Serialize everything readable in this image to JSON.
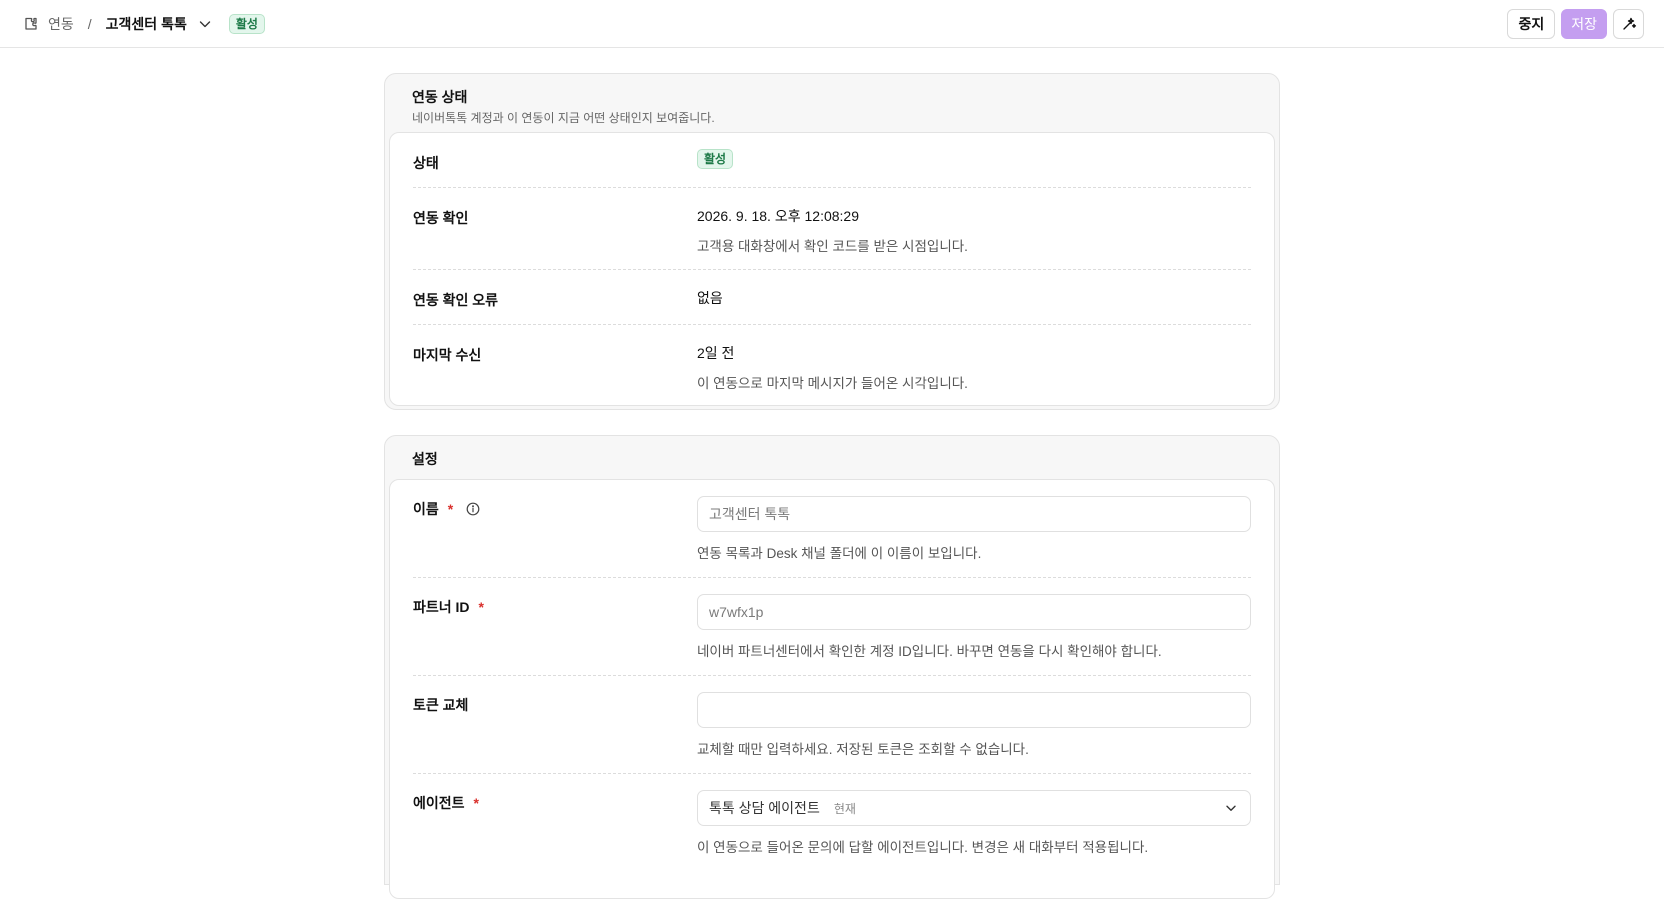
{
  "breadcrumb": {
    "root_icon": "plug-icon",
    "root_label": "연동",
    "separator": "/",
    "current_label": "고객센터 톡톡",
    "status_badge": "활성"
  },
  "toolbar": {
    "stop_label": "중지",
    "save_label": "저장",
    "ai_icon": "sparkle-icon"
  },
  "status_card": {
    "title": "연동 상태",
    "description": "네이버톡톡 계정과 이 연동이 지금 어떤 상태인지 보여줍니다.",
    "rows": [
      {
        "label": "상태",
        "badge": "활성"
      },
      {
        "label": "연동 확인",
        "value": "2026. 9. 18. 오후 12:08:29",
        "sub": "고객용 대화창에서 확인 코드를 받은 시점입니다."
      },
      {
        "label": "연동 확인 오류",
        "value": "없음"
      },
      {
        "label": "마지막 수신",
        "value": "2일 전",
        "sub": "이 연동으로 마지막 메시지가 들어온 시각입니다."
      }
    ]
  },
  "settings_card": {
    "title": "설정",
    "name_field": {
      "label": "이름",
      "required": "*",
      "value": "",
      "placeholder": "고객센터 톡톡",
      "hint": "연동 목록과 Desk 채널 폴더에 이 이름이 보입니다."
    },
    "partner_field": {
      "label": "파트너 ID",
      "required": "*",
      "value": "",
      "placeholder": "w7wfx1p",
      "hint": "네이버 파트너센터에서 확인한 계정 ID입니다. 바꾸면 연동을 다시 확인해야 합니다."
    },
    "token_field": {
      "label": "토큰 교체",
      "value": "",
      "placeholder": "",
      "hint": "교체할 때만 입력하세요. 저장된 토큰은 조회할 수 없습니다."
    },
    "agent_field": {
      "label": "에이전트",
      "required": "*",
      "selected": "톡톡 상담 에이전트",
      "selected_tag": "현재",
      "hint": "이 연동으로 들어온 문의에 답할 에이전트입니다. 변경은 새 대화부터 적용됩니다."
    }
  }
}
